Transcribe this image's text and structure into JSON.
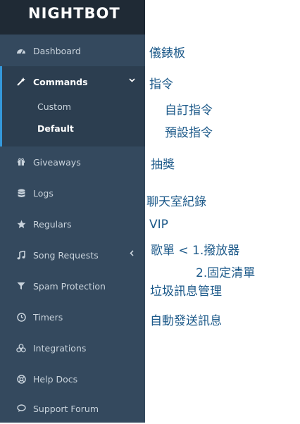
{
  "brand": {
    "logo": "NIGHTBOT"
  },
  "sidebar": {
    "items": [
      {
        "label": "Dashboard",
        "icon": "dashboard-icon"
      },
      {
        "label": "Commands",
        "icon": "magic-wand-icon",
        "expanded": true,
        "children": [
          {
            "label": "Custom"
          },
          {
            "label": "Default"
          }
        ]
      },
      {
        "label": "Giveaways",
        "icon": "gift-icon"
      },
      {
        "label": "Logs",
        "icon": "database-icon"
      },
      {
        "label": "Regulars",
        "icon": "star-icon"
      },
      {
        "label": "Song Requests",
        "icon": "music-note-icon"
      },
      {
        "label": "Spam Protection",
        "icon": "filter-icon"
      },
      {
        "label": "Timers",
        "icon": "clock-icon"
      },
      {
        "label": "Integrations",
        "icon": "cubes-icon"
      },
      {
        "label": "Help Docs",
        "icon": "life-ring-icon"
      },
      {
        "label": "Support Forum",
        "icon": "chat-icon"
      }
    ]
  },
  "annotations": {
    "dashboard": "儀錶板",
    "commands": "指令",
    "custom": "自訂指令",
    "default": "預設指令",
    "giveaways": "抽獎",
    "logs": "聊天室紀錄",
    "regulars": "VIP",
    "song_requests": "歌單 < 1.撥放器",
    "song_requests_2": "2.固定清單",
    "spam": "垃圾訊息管理",
    "timers": "自動發送訊息"
  },
  "colors": {
    "sidebar_bg": "#34495e",
    "logo_bar_bg": "#1f2a35",
    "active_bg": "#2c3e50",
    "accent": "#3498db",
    "annotation_text": "#1d5a8a"
  }
}
